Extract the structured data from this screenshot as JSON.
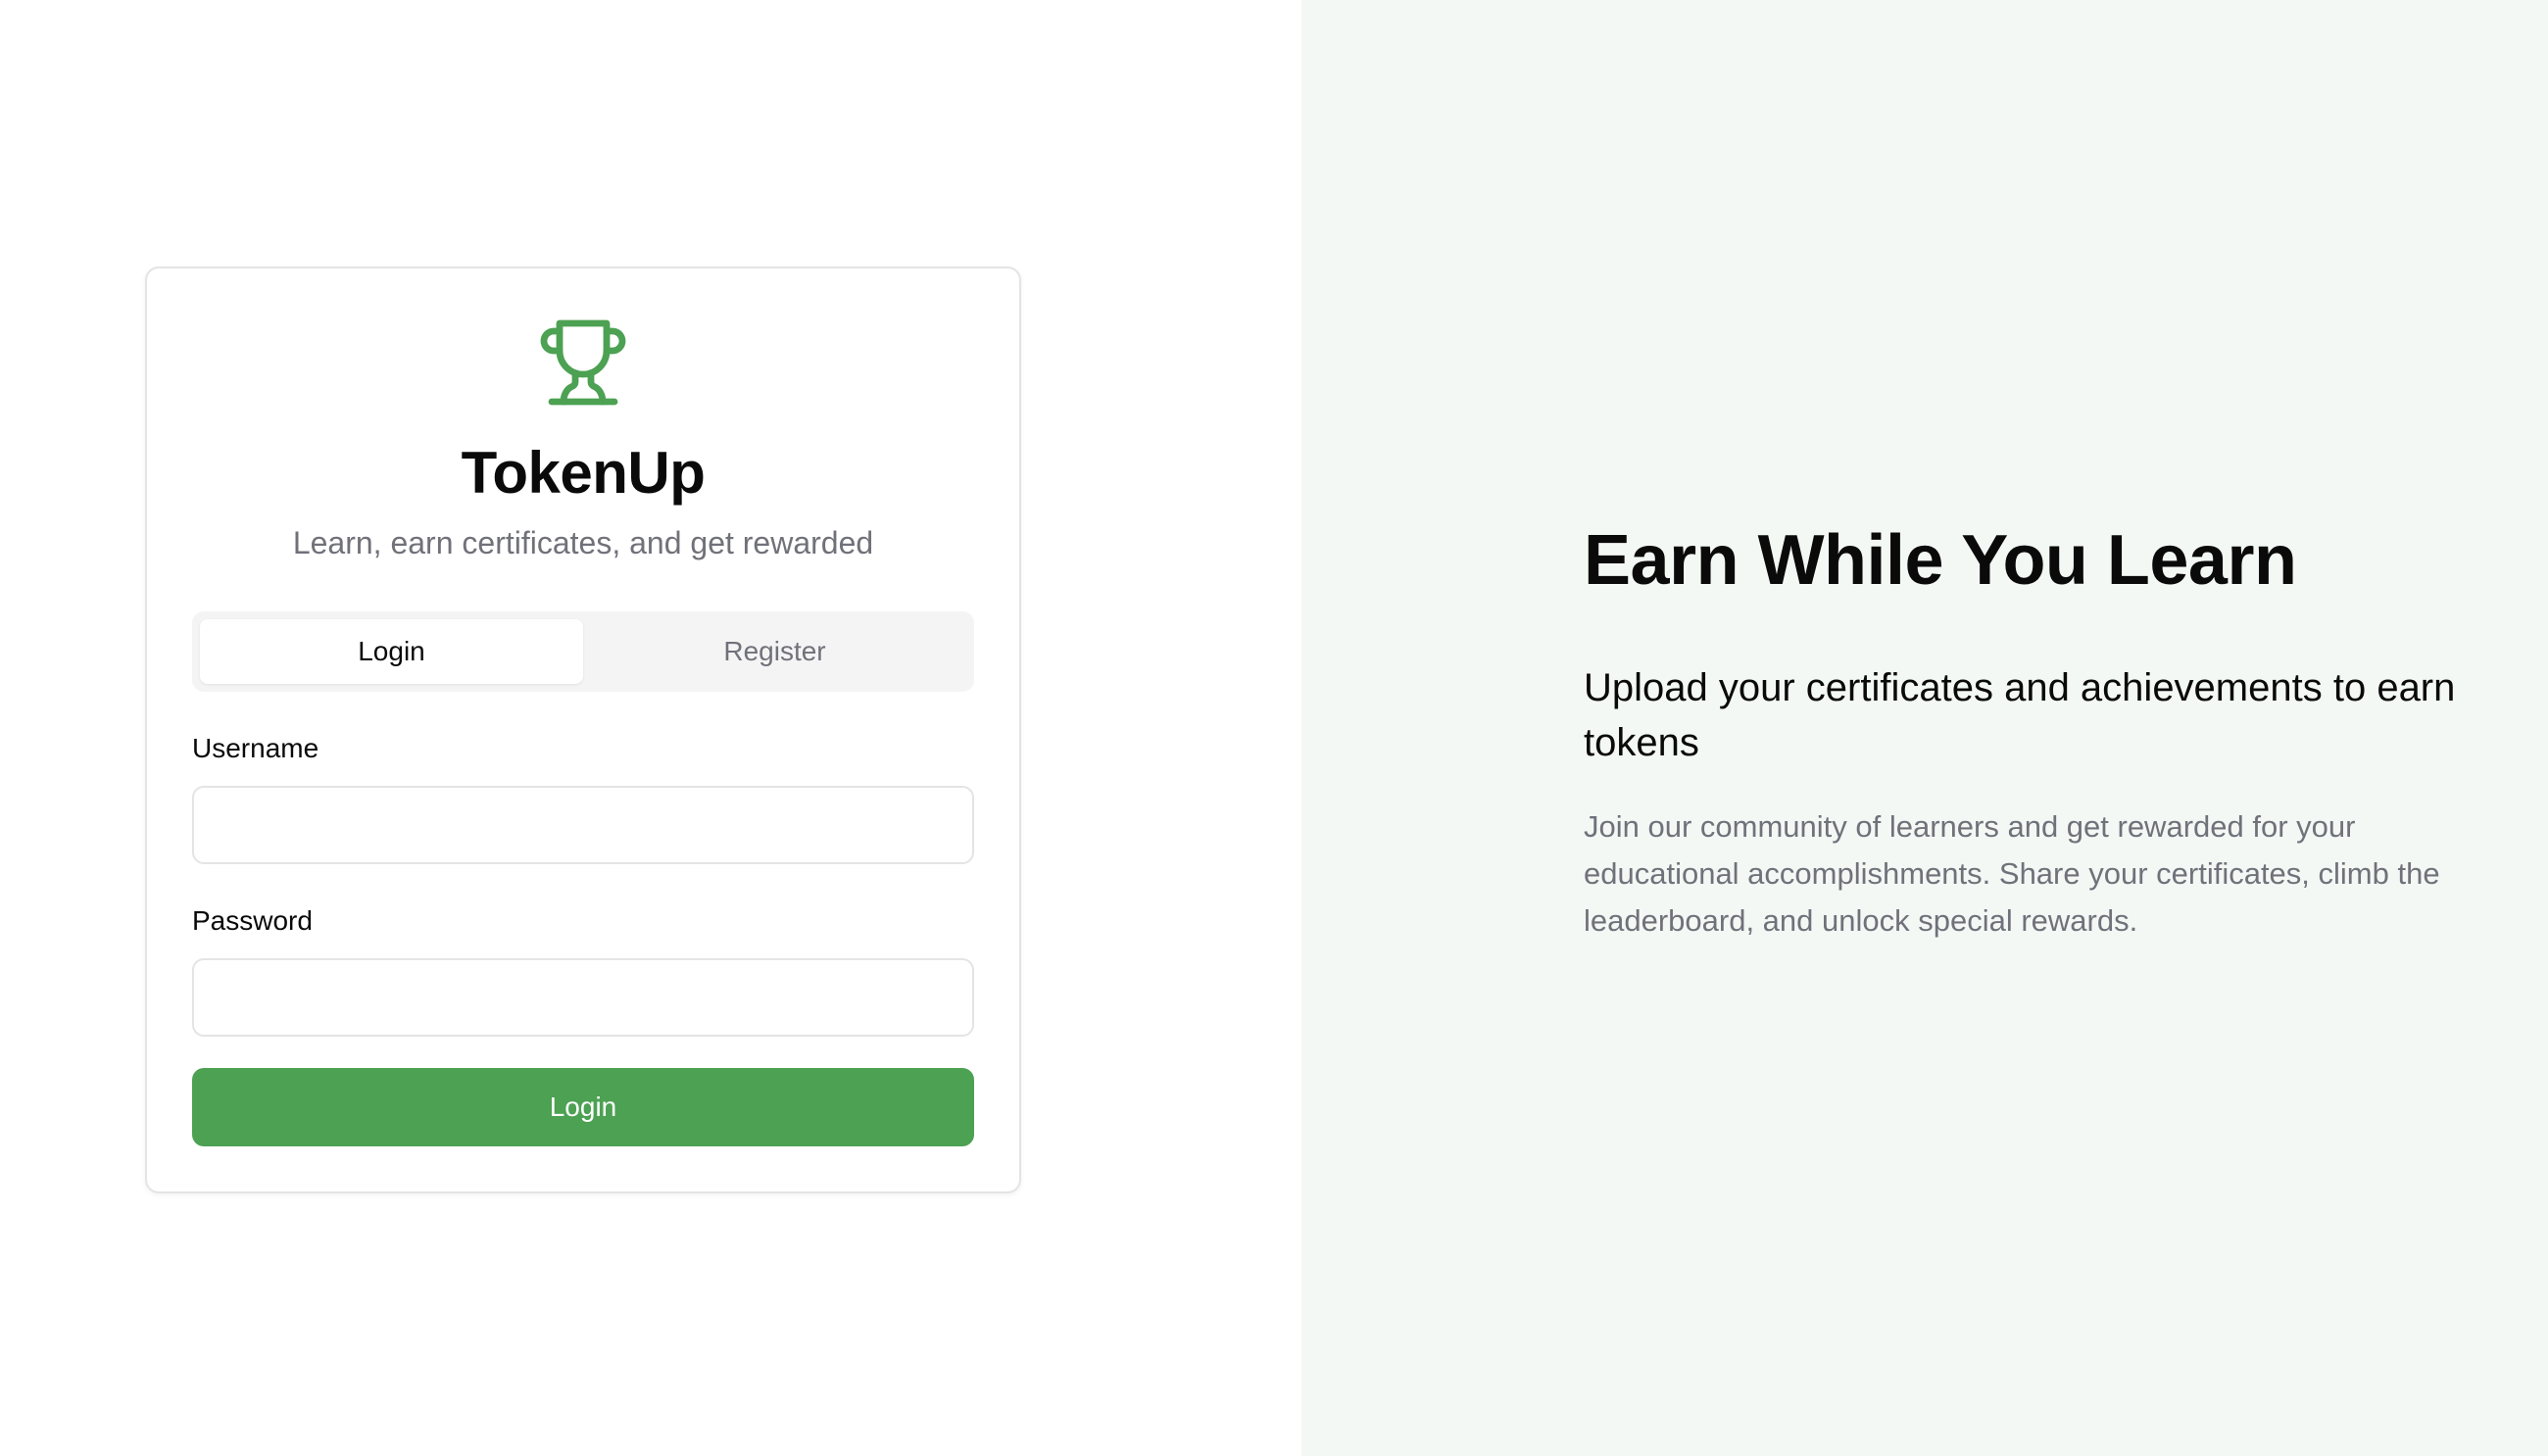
{
  "brand": {
    "name": "TokenUp",
    "tagline": "Learn, earn certificates, and get rewarded",
    "icon": "trophy-icon",
    "accent_color": "#4ca152"
  },
  "auth": {
    "tabs": [
      {
        "label": "Login",
        "active": true
      },
      {
        "label": "Register",
        "active": false
      }
    ],
    "username": {
      "label": "Username",
      "value": "",
      "placeholder": ""
    },
    "password": {
      "label": "Password",
      "value": "",
      "placeholder": ""
    },
    "submit_label": "Login"
  },
  "hero": {
    "title": "Earn While You Learn",
    "subtitle": "Upload your certificates and achievements to earn tokens",
    "body": "Join our community of learners and get rewarded for your educational accomplishments. Share your certificates, climb the leaderboard, and unlock special rewards.",
    "background_color": "#f4f8f5"
  }
}
